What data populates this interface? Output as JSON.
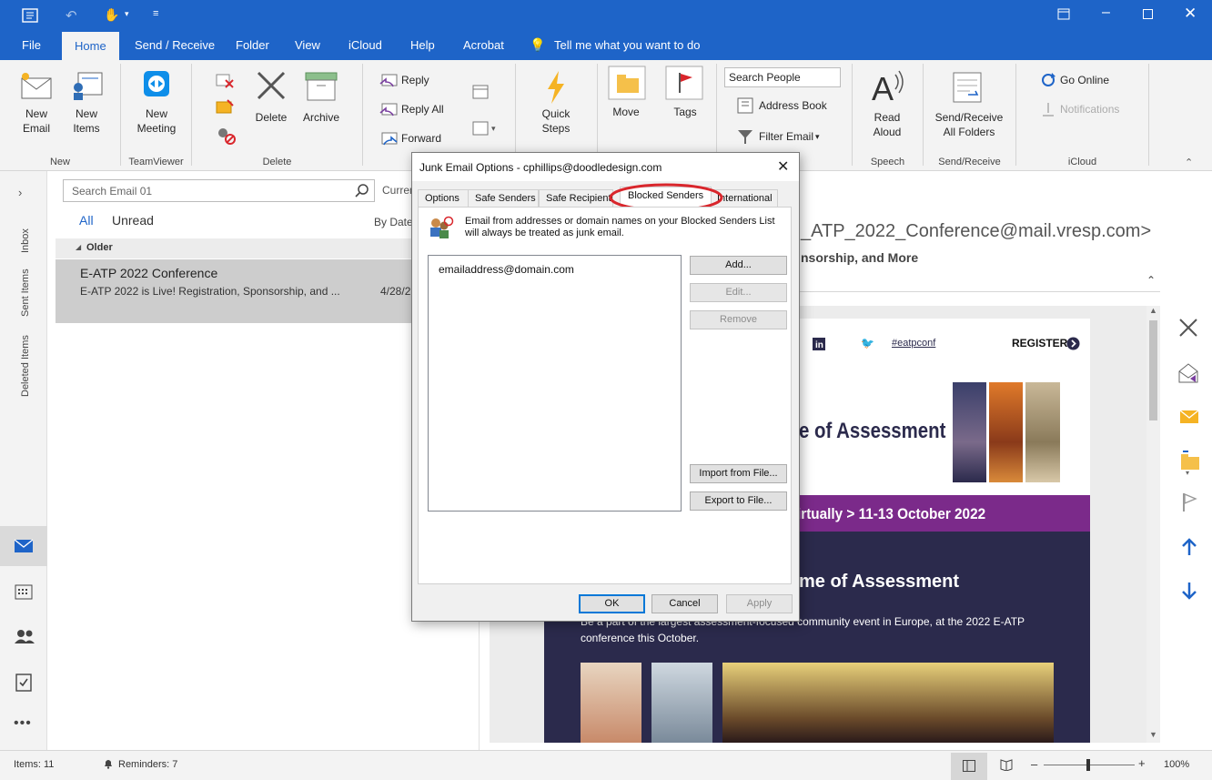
{
  "window": {
    "ribbon_tabs": [
      "File",
      "Home",
      "Send / Receive",
      "Folder",
      "View",
      "iCloud",
      "Help",
      "Acrobat"
    ],
    "tell_me": "Tell me what you want to do"
  },
  "ribbon": {
    "new_email": "New Email",
    "new_items": "New Items",
    "new_meeting": "New Meeting",
    "delete": "Delete",
    "archive": "Archive",
    "reply": "Reply",
    "reply_all": "Reply All",
    "forward": "Forward",
    "quick_steps": "Quick Steps",
    "move": "Move",
    "tags": "Tags",
    "search_people": "Search People",
    "address_book": "Address Book",
    "filter_email": "Filter Email",
    "read_aloud": "Read Aloud",
    "send_receive_all": "Send/Receive All Folders",
    "go_online": "Go Online",
    "notifications": "Notifications",
    "groups": {
      "new": "New",
      "teamviewer": "TeamViewer",
      "delete": "Delete",
      "speech": "Speech",
      "send_receive": "Send/Receive",
      "icloud": "iCloud"
    }
  },
  "nav": {
    "folders": [
      "Inbox",
      "Sent Items",
      "Deleted Items"
    ]
  },
  "maillist": {
    "search_placeholder": "Search Email 01",
    "scope": "Curren",
    "filter_all": "All",
    "filter_unread": "Unread",
    "sort": "By Date",
    "group": "Older",
    "item": {
      "sender": "E-ATP 2022 Conference",
      "preview": "E-ATP 2022 is Live! Registration, Sponsorship, and ...",
      "date": "4/28/2"
    }
  },
  "reading": {
    "from": "_ATP_2022_Conference@mail.vresp.com>",
    "subject": "nsorship, and More",
    "hashtag": "#eatpconf",
    "register": "REGISTER",
    "headline": "e of Assessment",
    "banner": "irtually > 11-13 October 2022",
    "headline2": "me of Assessment",
    "body": "Be a part of the largest assessment-focused community event in Europe, at the 2022 E-ATP conference this October."
  },
  "status": {
    "items": "Items: 11",
    "reminders": "Reminders: 7",
    "zoom": "100%"
  },
  "dialog": {
    "title": "Junk Email Options - cphillips@doodledesign.com",
    "tabs": [
      "Options",
      "Safe Senders",
      "Safe Recipients",
      "Blocked Senders",
      "International"
    ],
    "description": "Email from addresses or domain names on your Blocked Senders List will always be treated as junk email.",
    "list_items": [
      "emailaddress@domain.com"
    ],
    "add": "Add...",
    "edit": "Edit...",
    "remove": "Remove",
    "import": "Import from File...",
    "export": "Export to File...",
    "ok": "OK",
    "cancel": "Cancel",
    "apply": "Apply"
  },
  "colors": {
    "accent": "#1e64c8",
    "highlight": "#d9262c",
    "banner": "#7b2a8a",
    "newsletter_bg": "#2b2a4c"
  }
}
